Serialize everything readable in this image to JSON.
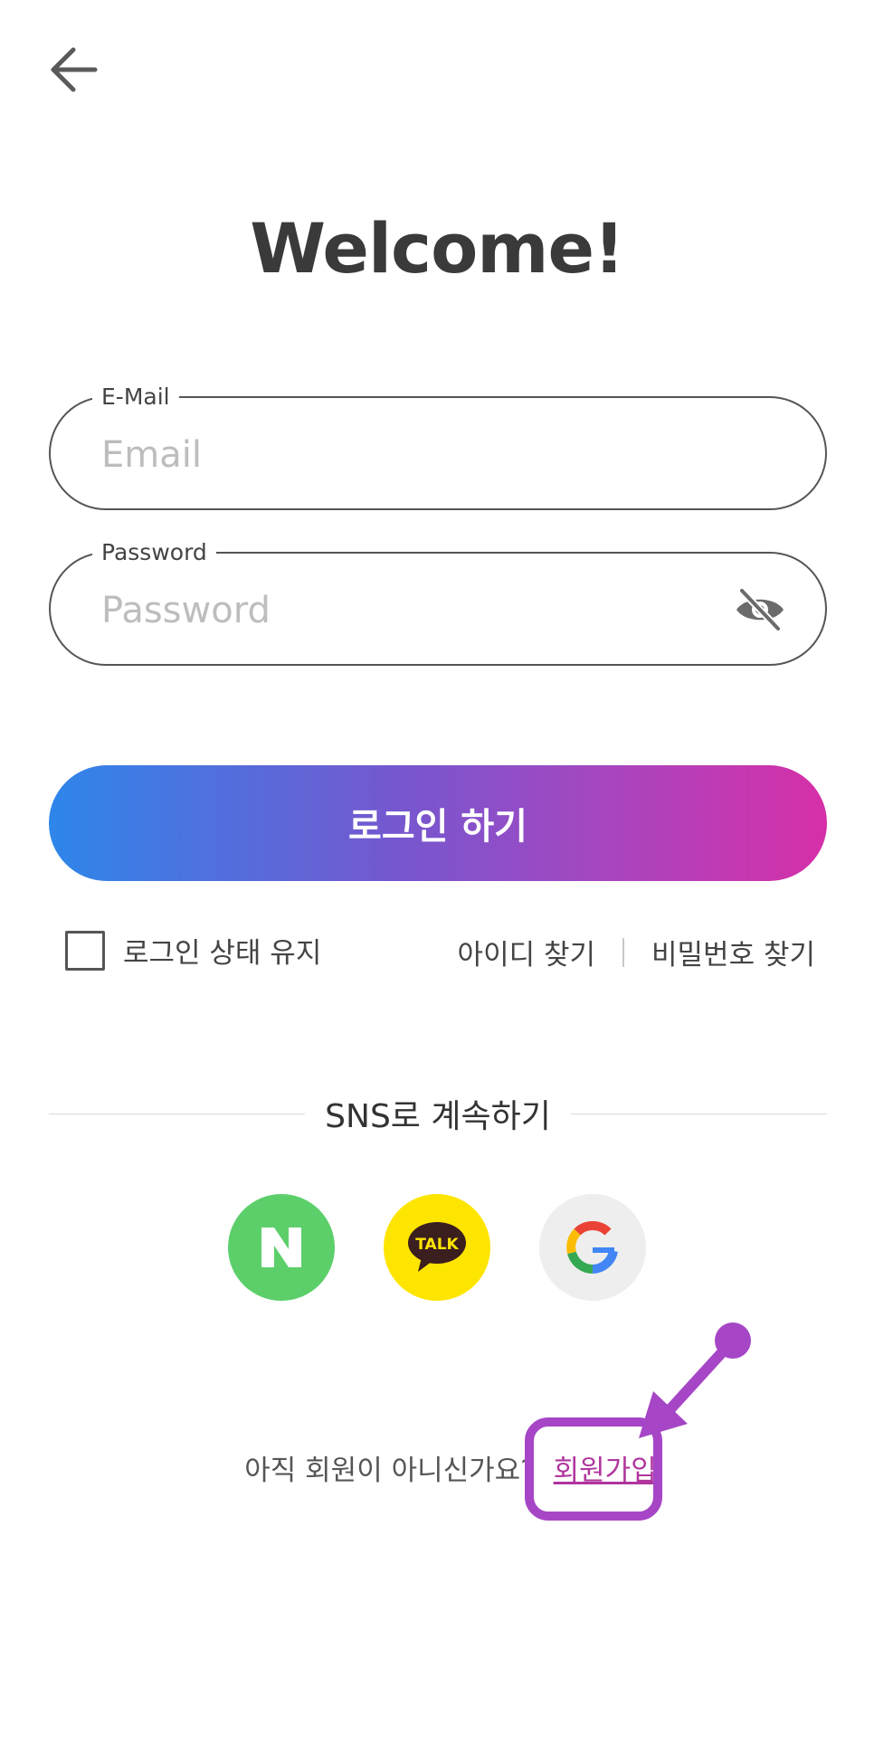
{
  "header": {
    "back_icon": "arrow-left-icon"
  },
  "title": "Welcome!",
  "email_field": {
    "label": "E-Mail",
    "placeholder": "Email",
    "value": ""
  },
  "password_field": {
    "label": "Password",
    "placeholder": "Password",
    "value": "",
    "toggle_icon": "eye-off-icon"
  },
  "login_button": {
    "label": "로그인 하기",
    "gradient": [
      "#2e86ea",
      "#7657cf",
      "#a447c0",
      "#d62fa8"
    ]
  },
  "options": {
    "remember_label": "로그인 상태 유지",
    "remember_checked": false,
    "find_id": "아이디 찾기",
    "find_password": "비밀번호 찾기"
  },
  "sns": {
    "label": "SNS로 계속하기",
    "buttons": [
      {
        "name": "naver",
        "icon": "naver-icon",
        "glyph": "N",
        "color": "#5ccf6a"
      },
      {
        "name": "kakao",
        "icon": "kakao-talk-icon",
        "glyph": "TALK",
        "color": "#fee500"
      },
      {
        "name": "google",
        "icon": "google-icon",
        "glyph": "G",
        "color": "#eeeeee"
      }
    ]
  },
  "signup": {
    "prompt": "아직 회원이 아니신가요?",
    "link": "회원가입"
  },
  "annotation": {
    "color": "#a646c6"
  }
}
